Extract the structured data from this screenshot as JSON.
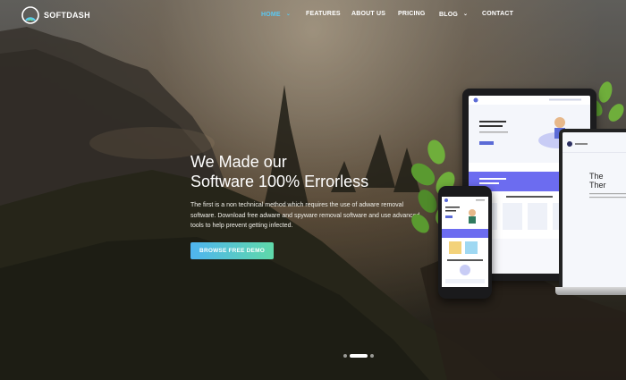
{
  "brand": {
    "name": "SOFTDASH",
    "logo_icon": "arc-logo-icon"
  },
  "nav": {
    "items": [
      {
        "label": "HOME",
        "active": true,
        "dropdown": true
      },
      {
        "label": "FEATURES",
        "active": false,
        "dropdown": false
      },
      {
        "label": "ABOUT US",
        "active": false,
        "dropdown": false
      },
      {
        "label": "PRICING",
        "active": false,
        "dropdown": false
      },
      {
        "label": "BLOG",
        "active": false,
        "dropdown": true
      },
      {
        "label": "CONTACT",
        "active": false,
        "dropdown": false
      }
    ]
  },
  "hero": {
    "headline_line1": "We Made our",
    "headline_line2": "Software 100% Errorless",
    "description": "The first is a non technical method which requires the use of adware removal software. Download free adware and spyware removal software and use advanced tools to help prevent getting infected.",
    "cta_label": "BROWSE FREE DEMO"
  },
  "slider": {
    "slides": 3,
    "active_index": 1
  },
  "colors": {
    "accent": "#5bc8f2",
    "cta_start": "#4fb4f0",
    "cta_end": "#5fd9a9"
  }
}
